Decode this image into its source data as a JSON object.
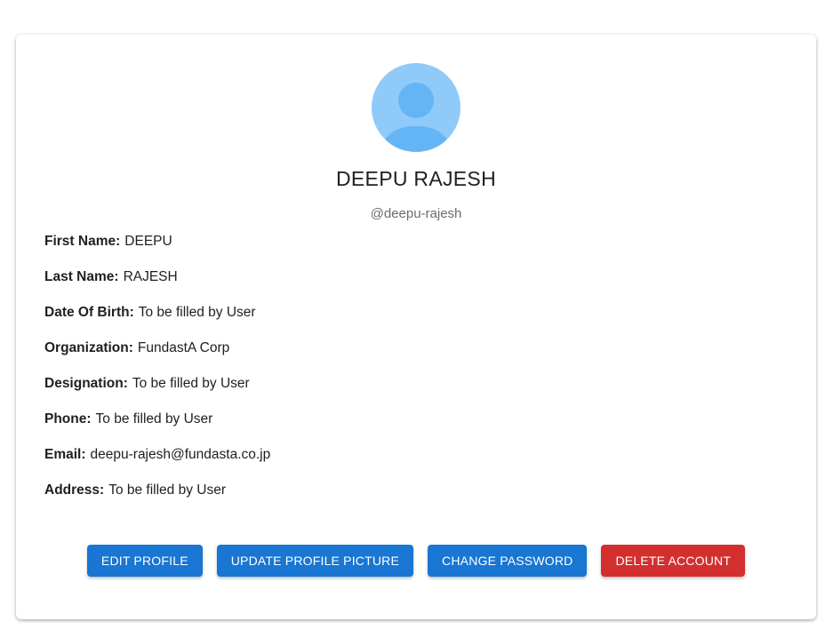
{
  "profile": {
    "display_name": "DEEPU RAJESH",
    "username": "@deepu-rajesh",
    "avatar_icon": "user-avatar-icon",
    "avatar_bg": "#90caf9",
    "avatar_fg": "#64b5f6"
  },
  "fields": [
    {
      "label": "First Name:",
      "value": "DEEPU"
    },
    {
      "label": "Last Name:",
      "value": "RAJESH"
    },
    {
      "label": "Date Of Birth:",
      "value": "To be filled by User"
    },
    {
      "label": "Organization:",
      "value": "FundastA Corp"
    },
    {
      "label": "Designation:",
      "value": "To be filled by User"
    },
    {
      "label": "Phone:",
      "value": "To be filled by User"
    },
    {
      "label": "Email:",
      "value": "deepu-rajesh@fundasta.co.jp"
    },
    {
      "label": "Address:",
      "value": "To be filled by User"
    }
  ],
  "actions": {
    "edit_profile": "EDIT PROFILE",
    "update_picture": "UPDATE PROFILE PICTURE",
    "change_password": "CHANGE PASSWORD",
    "delete_account": "DELETE ACCOUNT"
  },
  "colors": {
    "primary": "#1976d2",
    "danger": "#d32f2f"
  }
}
